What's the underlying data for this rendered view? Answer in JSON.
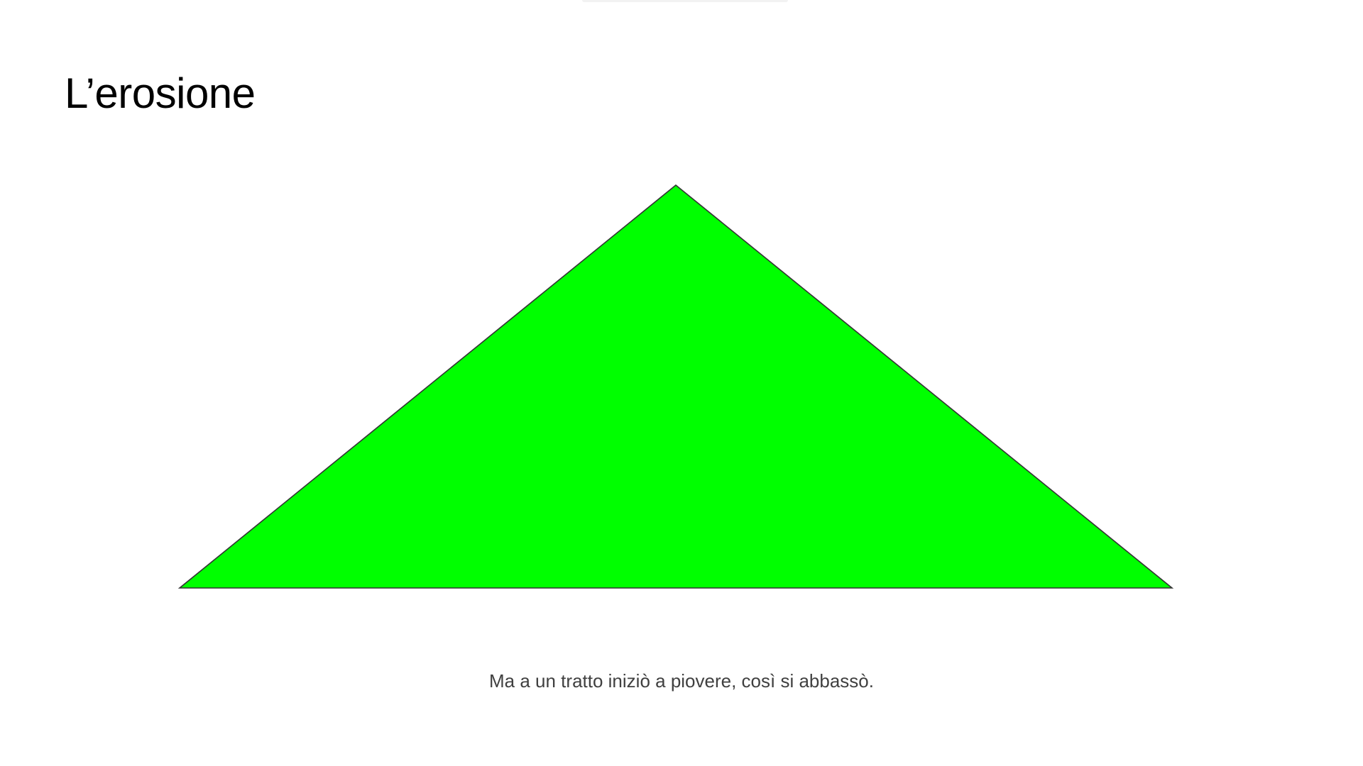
{
  "slide": {
    "title": "L’erosione",
    "caption": "Ma a un tratto iniziò a piovere, così si abbassò."
  },
  "shapes": {
    "mountain": {
      "fill": "#00ff00",
      "stroke": "#333333"
    }
  }
}
